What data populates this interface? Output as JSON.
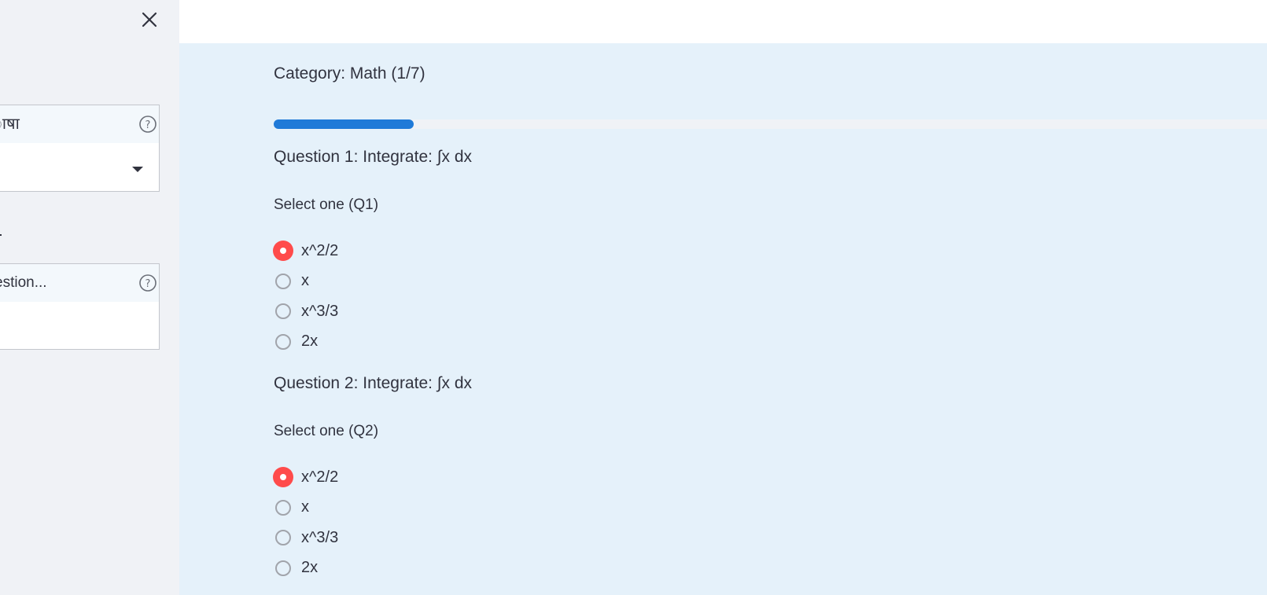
{
  "sidebar": {
    "close_icon": "close-icon",
    "language_field": {
      "label": "ाषा",
      "help_icon": "help-circle-icon",
      "caret_icon": "caret-down-icon",
      "value": ""
    },
    "question_field": {
      "label": "estion...",
      "help_icon": "help-circle-icon",
      "value": ""
    }
  },
  "main": {
    "category": "Category: Math (1/7)",
    "progress": {
      "current": 1,
      "total": 7,
      "fraction": 0.141,
      "fill_color": "#1f7ad8"
    },
    "questions": [
      {
        "title": "Question 1: Integrate: ∫x dx",
        "prompt": "Select one (Q1)",
        "options": [
          "x^2/2",
          "x",
          "x^3/3",
          "2x"
        ],
        "selected_index": 0
      },
      {
        "title": "Question 2: Integrate: ∫x dx",
        "prompt": "Select one (Q2)",
        "options": [
          "x^2/2",
          "x",
          "x^3/3",
          "2x"
        ],
        "selected_index": 0
      }
    ]
  },
  "colors": {
    "sidebar_bg": "#f0f2f6",
    "main_bg": "#e5f1fa",
    "radio_selected": "#ff4b4b",
    "progress": "#1f7ad8"
  }
}
